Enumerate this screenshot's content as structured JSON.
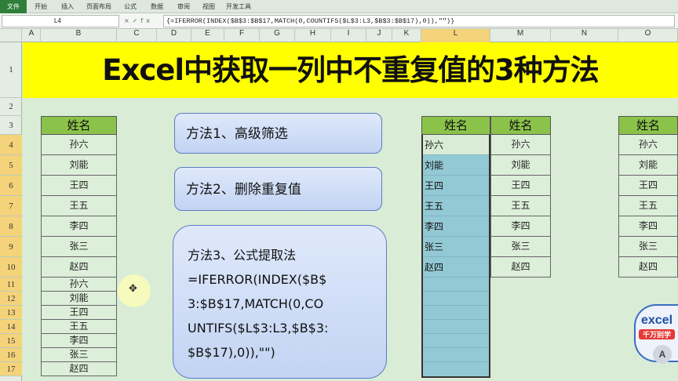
{
  "ribbon": {
    "tabs": [
      "文件",
      "开始",
      "插入",
      "页面布局",
      "公式",
      "数据",
      "审阅",
      "视图",
      "开发工具"
    ]
  },
  "formula_bar": {
    "name_box": "L4",
    "fx": "×✓fx",
    "formula": "{=IFERROR(INDEX($B$3:$B$17,MATCH(0,COUNTIFS($L$3:L3,$B$3:$B$17),0)),\"\")}"
  },
  "columns": [
    "A",
    "B",
    "C",
    "D",
    "E",
    "F",
    "G",
    "H",
    "I",
    "J",
    "K",
    "L",
    "M",
    "N",
    "O"
  ],
  "rows": [
    "1",
    "2",
    "3",
    "4",
    "5",
    "6",
    "7",
    "8",
    "9",
    "10",
    "11",
    "12",
    "13",
    "14",
    "15",
    "16",
    "17"
  ],
  "selected_column": "L",
  "title": "Excel中获取一列中不重复值的3种方法",
  "table_b": {
    "header": "姓名",
    "values": [
      "孙六",
      "刘能",
      "王四",
      "王五",
      "李四",
      "张三",
      "赵四",
      "孙六",
      "刘能",
      "王四",
      "王五",
      "李四",
      "张三",
      "赵四"
    ]
  },
  "table_l": {
    "header": "姓名",
    "values": [
      "孙六",
      "刘能",
      "王四",
      "王五",
      "李四",
      "张三",
      "赵四"
    ]
  },
  "table_m": {
    "header": "姓名",
    "values": [
      "孙六",
      "刘能",
      "王四",
      "王五",
      "李四",
      "张三",
      "赵四"
    ]
  },
  "table_o": {
    "header": "姓名",
    "values": [
      "孙六",
      "刘能",
      "王四",
      "王五",
      "李四",
      "张三",
      "赵四"
    ]
  },
  "methods": {
    "m1": "方法1、高级筛选",
    "m2": "方法2、删除重复值",
    "m3_lines": [
      "方法3、公式提取法",
      "=IFERROR(INDEX($B$",
      "3:$B$17,MATCH(0,CO",
      "UNTIFS($L$3:L3,$B$3:",
      "$B$17),0)),\"\")"
    ]
  },
  "watermark": {
    "word": "excel",
    "sub": "千万别学",
    "badge": "A"
  },
  "colors": {
    "title_bg": "#ffff00",
    "header_green": "#8bc34a",
    "sheet_bg": "#d9ecd6",
    "selection": "#93c9d4"
  }
}
